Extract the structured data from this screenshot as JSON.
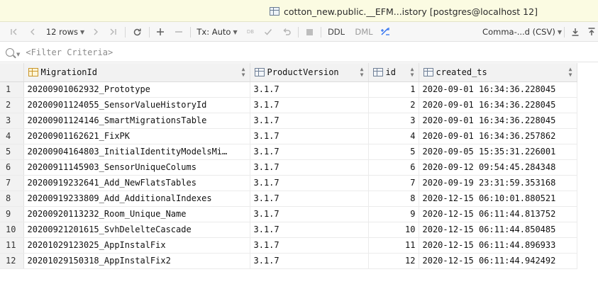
{
  "tab": {
    "title": "cotton_new.public.__EFM...istory [postgres@localhost 12]"
  },
  "toolbar": {
    "rows_label": "12 rows",
    "tx_label": "Tx: Auto",
    "db_label": "DB",
    "ddl_label": "DDL",
    "dml_label": "DML",
    "export_format": "Comma-...d (CSV)"
  },
  "filter": {
    "placeholder": "<Filter Criteria>"
  },
  "columns": [
    {
      "name": "MigrationId",
      "icon": "primary-key-column-icon"
    },
    {
      "name": "ProductVersion",
      "icon": "column-icon"
    },
    {
      "name": "id",
      "icon": "column-icon"
    },
    {
      "name": "created_ts",
      "icon": "column-icon"
    }
  ],
  "rows": [
    {
      "n": "1",
      "migration_id": "20200901062932_Prototype",
      "product_version": "3.1.7",
      "id": "1",
      "created_ts": "2020-09-01 16:34:36.228045"
    },
    {
      "n": "2",
      "migration_id": "20200901124055_SensorValueHistoryId",
      "product_version": "3.1.7",
      "id": "2",
      "created_ts": "2020-09-01 16:34:36.228045"
    },
    {
      "n": "3",
      "migration_id": "20200901124146_SmartMigrationsTable",
      "product_version": "3.1.7",
      "id": "3",
      "created_ts": "2020-09-01 16:34:36.228045"
    },
    {
      "n": "4",
      "migration_id": "20200901162621_FixPK",
      "product_version": "3.1.7",
      "id": "4",
      "created_ts": "2020-09-01 16:34:36.257862"
    },
    {
      "n": "5",
      "migration_id": "20200904164803_InitialIdentityModelsMi…",
      "product_version": "3.1.7",
      "id": "5",
      "created_ts": "2020-09-05 15:35:31.226001"
    },
    {
      "n": "6",
      "migration_id": "20200911145903_SensorUniqueColums",
      "product_version": "3.1.7",
      "id": "6",
      "created_ts": "2020-09-12 09:54:45.284348"
    },
    {
      "n": "7",
      "migration_id": "20200919232641_Add_NewFlatsTables",
      "product_version": "3.1.7",
      "id": "7",
      "created_ts": "2020-09-19 23:31:59.353168"
    },
    {
      "n": "8",
      "migration_id": "20200919233809_Add_AdditionalIndexes",
      "product_version": "3.1.7",
      "id": "8",
      "created_ts": "2020-12-15 06:10:01.880521"
    },
    {
      "n": "9",
      "migration_id": "20200920113232_Room_Unique_Name",
      "product_version": "3.1.7",
      "id": "9",
      "created_ts": "2020-12-15 06:11:44.813752"
    },
    {
      "n": "10",
      "migration_id": "20200921201615_SvhDelelteCascade",
      "product_version": "3.1.7",
      "id": "10",
      "created_ts": "2020-12-15 06:11:44.850485"
    },
    {
      "n": "11",
      "migration_id": "20201029123025_AppInstalFix",
      "product_version": "3.1.7",
      "id": "11",
      "created_ts": "2020-12-15 06:11:44.896933"
    },
    {
      "n": "12",
      "migration_id": "20201029150318_AppInstalFix2",
      "product_version": "3.1.7",
      "id": "12",
      "created_ts": "2020-12-15 06:11:44.942492"
    }
  ]
}
